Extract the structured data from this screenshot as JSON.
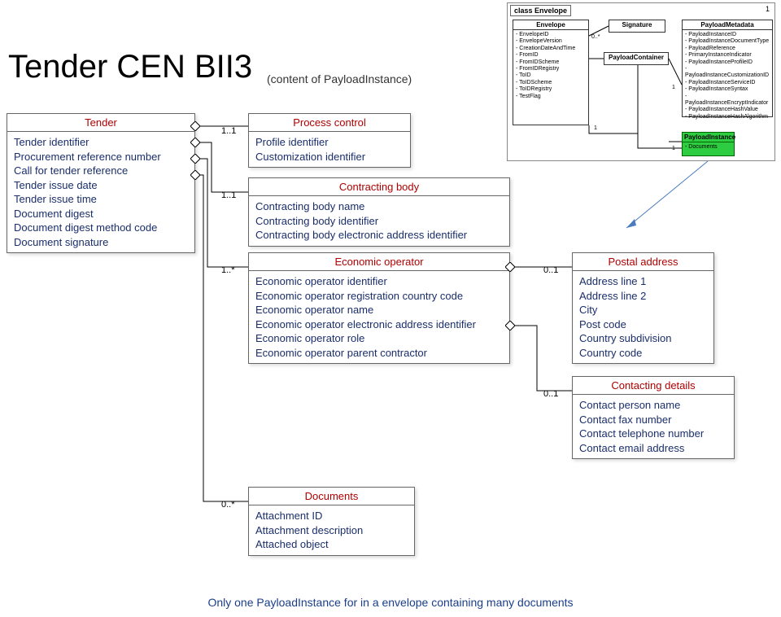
{
  "page": {
    "title": "Tender CEN BII3",
    "subtitle": "(content of PayloadInstance)",
    "footer": "Only one PayloadInstance for in a envelope containing many documents"
  },
  "boxes": {
    "tender": {
      "title": "Tender",
      "attrs": [
        "Tender identifier",
        "Procurement reference number",
        "Call for tender reference",
        "Tender issue date",
        "Tender issue time",
        "Document digest",
        "Document digest method code",
        "Document signature"
      ]
    },
    "process": {
      "title": "Process control",
      "attrs": [
        "Profile identifier",
        "Customization identifier"
      ]
    },
    "contracting": {
      "title": "Contracting body",
      "attrs": [
        "Contracting body name",
        "Contracting body identifier",
        "Contracting body electronic address identifier"
      ]
    },
    "economic": {
      "title": "Economic operator",
      "attrs": [
        "Economic operator identifier",
        "Economic operator registration country code",
        "Economic operator name",
        "Economic operator electronic address identifier",
        "Economic operator role",
        "Economic operator parent contractor"
      ]
    },
    "postal": {
      "title": "Postal address",
      "attrs": [
        "Address line 1",
        "Address line 2",
        "City",
        "Post code",
        "Country subdivision",
        "Country code"
      ]
    },
    "contact": {
      "title": "Contacting details",
      "attrs": [
        "Contact person name",
        "Contact fax number",
        "Contact telephone number",
        "Contact email address"
      ]
    },
    "documents": {
      "title": "Documents",
      "attrs": [
        "Attachment ID",
        "Attachment description",
        "Attached object"
      ]
    }
  },
  "mults": {
    "m1": "1..1",
    "m2": "1..1",
    "m3": "1..*",
    "m4": "0..1",
    "m5": "0..1",
    "m6": "0..*"
  },
  "mini": {
    "classLabel": "class Envelope",
    "pageNum": "1",
    "envelope": {
      "title": "Envelope",
      "attrs": [
        "EnvelopeID",
        "EnvelopeVersion",
        "CreationDateAndTime",
        "FromID",
        "FromIDScheme",
        "FromIDRegistry",
        "ToID",
        "ToIDScheme",
        "ToIDRegistry",
        "TestFlag"
      ]
    },
    "signature": {
      "title": "Signature"
    },
    "payloadmeta": {
      "title": "PayloadMetadata",
      "attrs": [
        "PayloadInstanceID",
        "PayloadInstanceDocumentType",
        "PayloadReference",
        "PrimaryInstanceIndicator",
        "PayloadInstanceProfileID",
        "PayloadInstanceCustomizationID",
        "PayloadInstanceServiceID",
        "PayloadInstanceSyntax",
        "PayloadInstanceEncryptIndicator",
        "PayloadInstanceHashValue",
        "PayloadInstanceHashAlgorithm"
      ]
    },
    "container": {
      "title": "PayloadContainer"
    },
    "payloadinstance": {
      "title": "PayloadInstance",
      "attrs": [
        "Documents"
      ]
    },
    "mults": {
      "a": "0..*",
      "b": "1",
      "c": "1",
      "d": "1"
    }
  }
}
